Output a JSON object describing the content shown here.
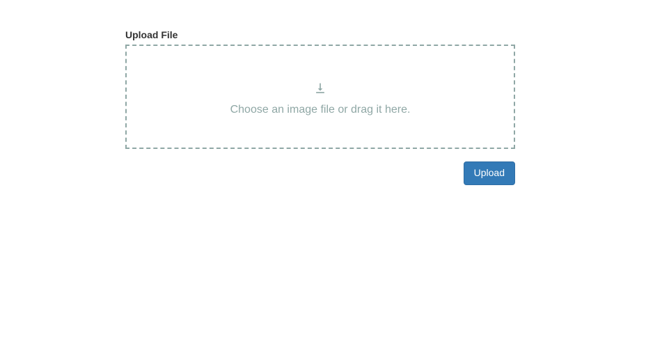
{
  "upload": {
    "section_label": "Upload File",
    "dropzone_text": "Choose an image file or drag it here.",
    "button_label": "Upload"
  }
}
